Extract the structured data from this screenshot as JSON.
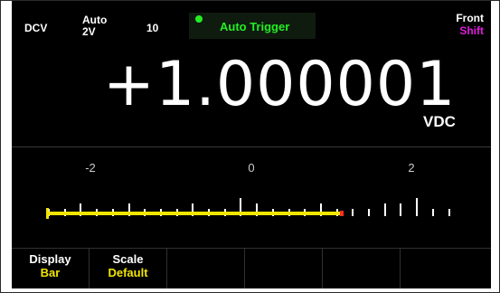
{
  "status_bar": {
    "function": "DCV",
    "range_mode": "Auto",
    "range_value": "2V",
    "sample_count": "10",
    "trigger": "Auto Trigger",
    "panel": "Front",
    "shift": "Shift"
  },
  "measurement": {
    "reading": "+1.000001",
    "unit": "VDC"
  },
  "bar_meter": {
    "scale_labels": [
      "-2",
      "0",
      "2"
    ],
    "scale_min": -2,
    "scale_max": 2,
    "value": 1.000001
  },
  "softkeys": [
    {
      "name": "Display",
      "value": "Bar"
    },
    {
      "name": "Scale",
      "value": "Default"
    },
    {
      "name": "",
      "value": ""
    },
    {
      "name": "",
      "value": ""
    },
    {
      "name": "",
      "value": ""
    },
    {
      "name": "",
      "value": ""
    }
  ],
  "colors": {
    "background": "#000000",
    "trigger_green": "#22ee22",
    "shift_magenta": "#e01bdc",
    "bar_yellow": "#f2e600",
    "marker_red": "#ff3020"
  }
}
